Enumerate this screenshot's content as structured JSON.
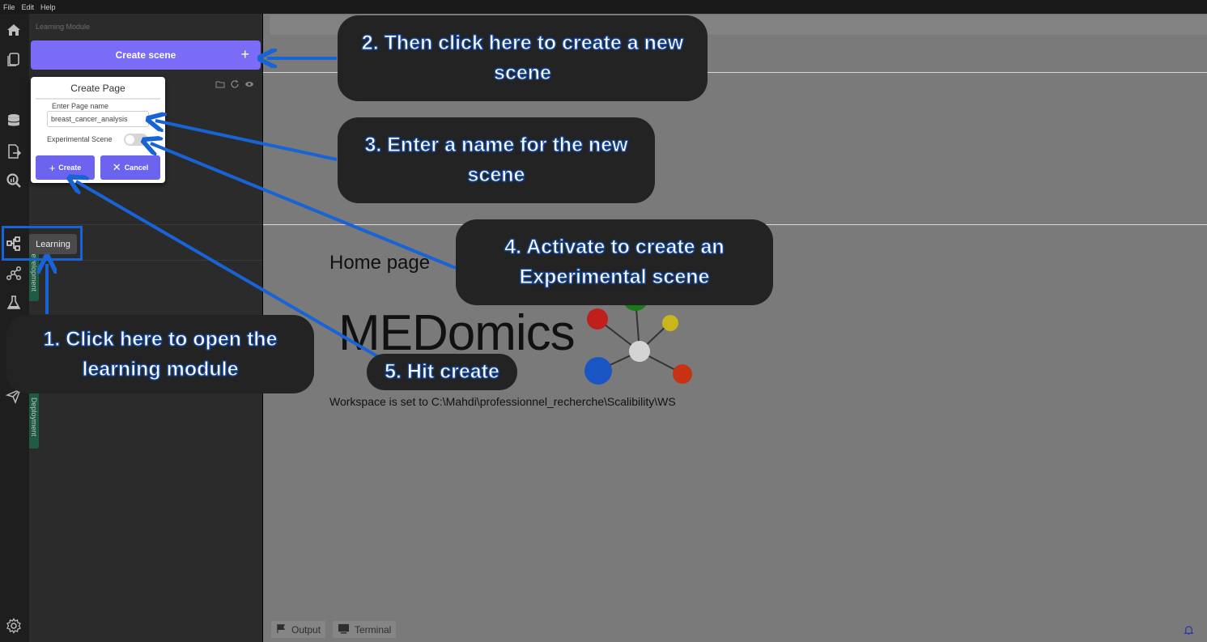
{
  "menubar": {
    "items": [
      "File",
      "Edit",
      "Help"
    ]
  },
  "panel": {
    "title": "Learning Module",
    "create_scene_label": "Create scene",
    "create_scene_icon": "+",
    "vertical_tabs": [
      "Development",
      "Deployment"
    ]
  },
  "dialog": {
    "title": "Create Page",
    "name_label": "Enter Page name",
    "name_value": "breast_cancer_analysis",
    "toggle_label": "Experimental Scene",
    "toggle_on": false,
    "create_label": "Create",
    "cancel_label": "Cancel"
  },
  "rail": {
    "icons": [
      "home-icon",
      "pages-icon",
      "database-icon",
      "file-export-icon",
      "analysis-icon",
      "learning-icon",
      "network-icon",
      "flask-icon",
      "users-icon",
      "send-icon",
      "settings-icon"
    ],
    "tooltip": "Learning"
  },
  "main": {
    "home_title": "Home page",
    "brand": "MEDomics",
    "workspace_text": "Workspace is set to C:\\Mahdi\\professionnel_recherche\\Scalibility\\WS"
  },
  "bottombar": {
    "output_label": "Output",
    "terminal_label": "Terminal"
  },
  "annotations": {
    "step1": "1.   Click here to open the learning module",
    "step2": "2. Then click here to create a new scene",
    "step3": "3. Enter a name for the new scene",
    "step4": "4. Activate to create an Experimental scene",
    "step5": "5. Hit create"
  },
  "colors": {
    "accent": "#7a6cf7",
    "button": "#6c63ee",
    "arrow": "#1863d6",
    "callout_bg": "#232323"
  }
}
